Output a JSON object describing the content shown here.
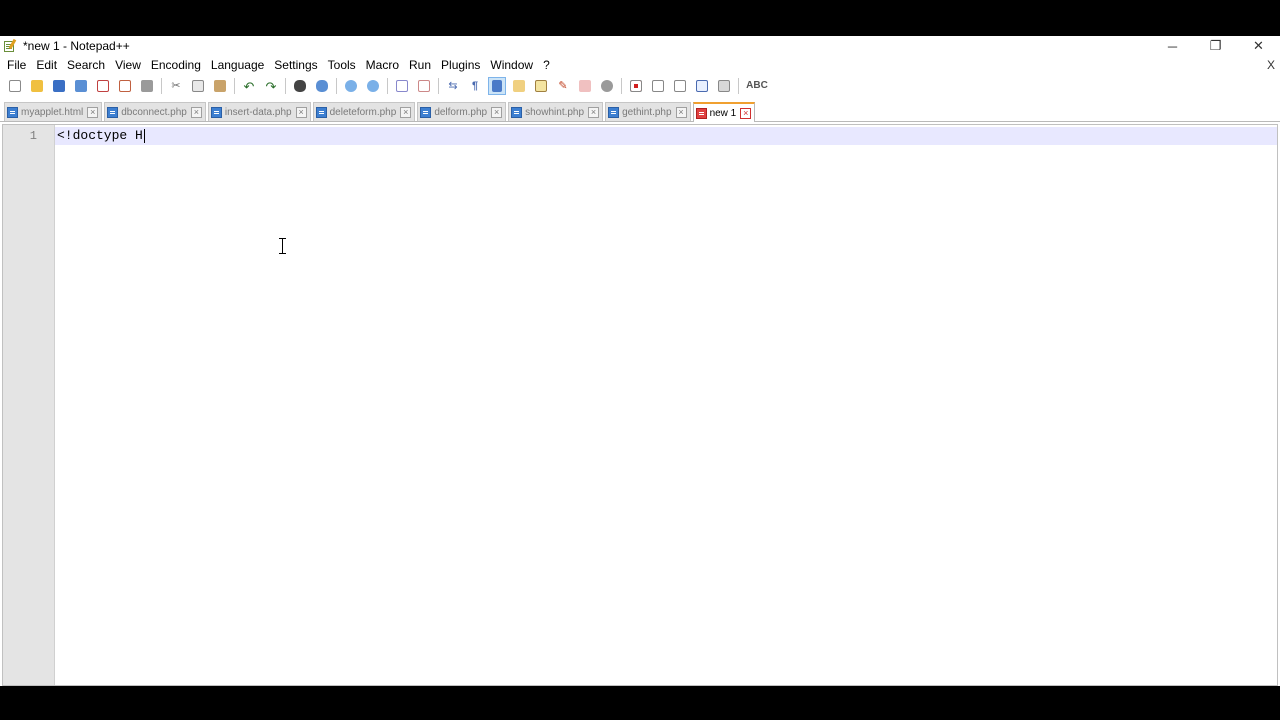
{
  "window": {
    "title": "*new 1 - Notepad++",
    "controls": {
      "minimize": "─",
      "restore": "❐",
      "close": "✕"
    }
  },
  "menu": {
    "items": [
      "File",
      "Edit",
      "Search",
      "View",
      "Encoding",
      "Language",
      "Settings",
      "Tools",
      "Macro",
      "Run",
      "Plugins",
      "Window",
      "?"
    ],
    "close_doc": "X"
  },
  "toolbar": {
    "spellcheck_label": "ABC"
  },
  "tabs": [
    {
      "label": "myapplet.html",
      "active": false
    },
    {
      "label": "dbconnect.php",
      "active": false
    },
    {
      "label": "insert-data.php",
      "active": false
    },
    {
      "label": "deleteform.php",
      "active": false
    },
    {
      "label": "delform.php",
      "active": false
    },
    {
      "label": "showhint.php",
      "active": false
    },
    {
      "label": "gethint.php",
      "active": false
    },
    {
      "label": "new 1",
      "active": true
    }
  ],
  "editor": {
    "line_number": "1",
    "code": "<!doctype H"
  }
}
